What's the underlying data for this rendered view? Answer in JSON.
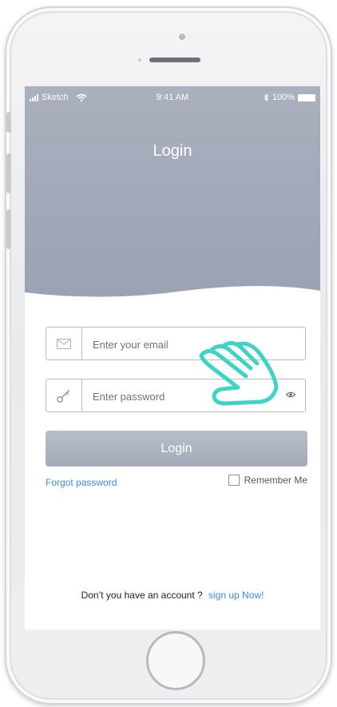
{
  "status_bar": {
    "carrier": "Sketch",
    "time": "9:41 AM",
    "battery": "100%"
  },
  "header": {
    "title": "Login"
  },
  "form": {
    "email_placeholder": "Enter your email",
    "password_placeholder": "Enter password",
    "login_label": "Login",
    "forgot_label": "Forgot password",
    "remember_label": "Remember Me",
    "remember_checked": false
  },
  "footer": {
    "question": "Don’t you have an account ?",
    "signup_label": "sign up Now!"
  },
  "colors": {
    "hero_top": "#aeb3c0",
    "hero_bottom": "#9aa1b1",
    "link": "#3d8be0",
    "hand_accent": "#3fd3c6"
  },
  "icons": [
    "mail-icon",
    "key-icon",
    "eye-icon",
    "signal-icon",
    "wifi-icon",
    "bluetooth-icon",
    "battery-icon",
    "tap-hand-icon"
  ]
}
